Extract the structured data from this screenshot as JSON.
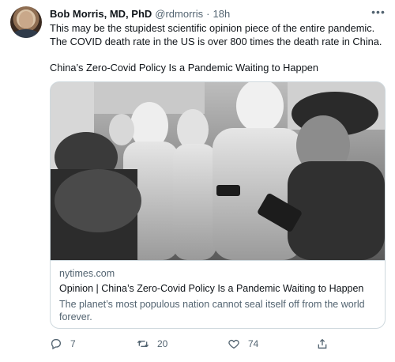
{
  "author": {
    "name": "Bob Morris, MD, PhD",
    "handle": "@rdmorris",
    "separator": "·",
    "time": "18h"
  },
  "tweet": {
    "line1": "This may be the stupidest scientific opinion piece of the entire pandemic.",
    "line2": "The COVID death rate in the US is over 800 times the death rate in China.",
    "line3": "China’s Zero-Covid Policy Is a Pandemic Waiting to Happen"
  },
  "card": {
    "domain": "nytimes.com",
    "title": "Opinion | China’s Zero-Covid Policy Is a Pandemic Waiting to Happen",
    "description": "The planet’s most populous nation cannot seal itself off from the world forever."
  },
  "actions": {
    "replies": "7",
    "retweets": "20",
    "likes": "74"
  },
  "icons": [
    "more-icon",
    "reply-icon",
    "retweet-icon",
    "like-icon",
    "share-icon"
  ],
  "colors": {
    "text": "#0f1419",
    "secondary": "#536471",
    "border": "#cfd9de"
  }
}
